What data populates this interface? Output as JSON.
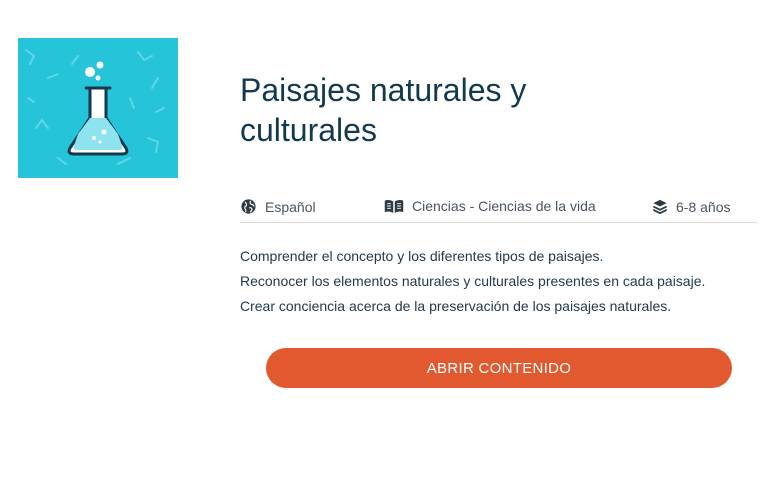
{
  "thumbnail": {
    "icon": "flask-icon",
    "background": "#25c4d9"
  },
  "title": "Paisajes naturales y culturales",
  "meta": {
    "language": {
      "icon": "globe-icon",
      "label": "Español"
    },
    "subject": {
      "icon": "book-icon",
      "label": "Ciencias - Ciencias de la vida"
    },
    "age": {
      "icon": "layers-icon",
      "label": "6-8 años"
    }
  },
  "objectives": [
    "Comprender el concepto y los diferentes tipos de paisajes.",
    "Reconocer los elementos naturales y culturales presentes en cada paisaje.",
    "Crear conciencia acerca de la preservación de los paisajes naturales."
  ],
  "action": {
    "label": "ABRIR CONTENIDO",
    "color": "#e2592f"
  }
}
